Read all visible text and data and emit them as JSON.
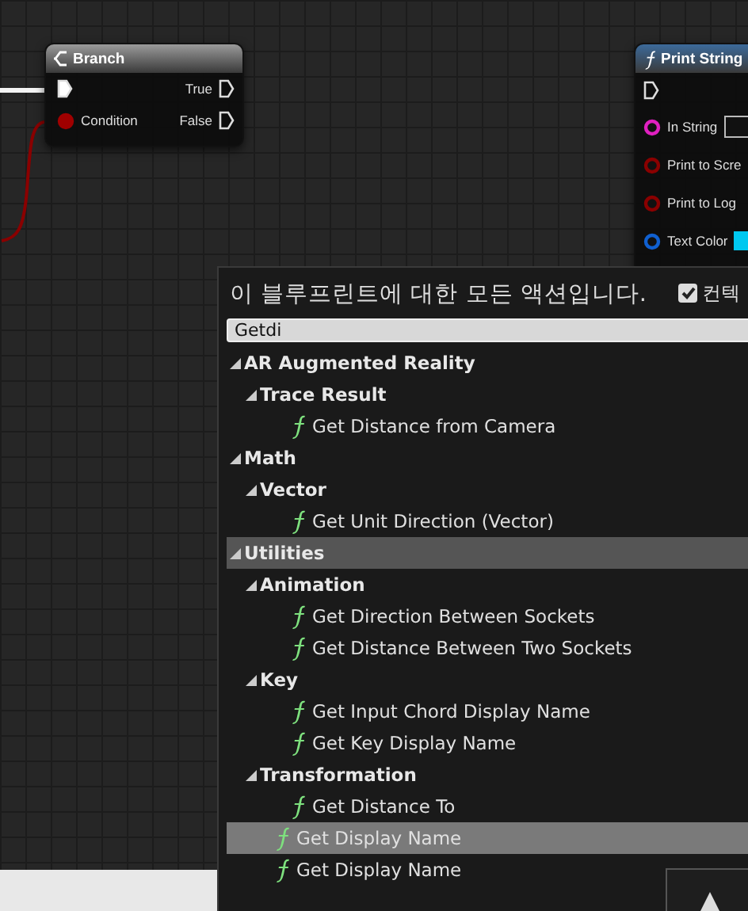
{
  "graph": {
    "branch_node": {
      "title": "Branch",
      "pins_left": [
        {
          "kind": "exec"
        },
        {
          "kind": "bool",
          "label": "Condition"
        }
      ],
      "pins_right": [
        {
          "kind": "exec",
          "label": "True"
        },
        {
          "kind": "exec",
          "label": "False"
        }
      ]
    },
    "print_node": {
      "title": "Print String",
      "pins": [
        {
          "kind": "exec"
        },
        {
          "kind": "string",
          "label": "In String",
          "color": "#e020c0"
        },
        {
          "kind": "bool",
          "label": "Print to Scre",
          "color": "#8a0000"
        },
        {
          "kind": "bool",
          "label": "Print to Log",
          "color": "#8a0000"
        },
        {
          "kind": "color",
          "label": "Text Color",
          "color": "#1060d0"
        }
      ]
    }
  },
  "action_menu": {
    "header": "이 블루프린트에 대한 모든 액션입니다.",
    "context_checkbox": {
      "label": "컨텍",
      "checked": true
    },
    "search": {
      "value": "Getdi"
    },
    "tree": [
      {
        "kind": "category",
        "label": "AR Augmented Reality",
        "expanded": true,
        "highlighted": false,
        "children": [
          {
            "kind": "category",
            "label": "Trace Result",
            "expanded": true,
            "highlighted": false,
            "children": [
              {
                "kind": "function",
                "label": "Get Distance from Camera",
                "selected": false
              }
            ]
          }
        ]
      },
      {
        "kind": "category",
        "label": "Math",
        "expanded": true,
        "highlighted": false,
        "children": [
          {
            "kind": "category",
            "label": "Vector",
            "expanded": true,
            "highlighted": false,
            "children": [
              {
                "kind": "function",
                "label": "Get Unit Direction (Vector)",
                "selected": false
              }
            ]
          }
        ]
      },
      {
        "kind": "category",
        "label": "Utilities",
        "expanded": true,
        "highlighted": true,
        "children": [
          {
            "kind": "category",
            "label": "Animation",
            "expanded": true,
            "highlighted": false,
            "children": [
              {
                "kind": "function",
                "label": "Get Direction Between Sockets",
                "selected": false
              },
              {
                "kind": "function",
                "label": "Get Distance Between Two Sockets",
                "selected": false
              }
            ]
          },
          {
            "kind": "category",
            "label": "Key",
            "expanded": true,
            "highlighted": false,
            "children": [
              {
                "kind": "function",
                "label": "Get Input Chord Display Name",
                "selected": false
              },
              {
                "kind": "function",
                "label": "Get Key Display Name",
                "selected": false
              }
            ]
          },
          {
            "kind": "category",
            "label": "Transformation",
            "expanded": true,
            "highlighted": false,
            "children": [
              {
                "kind": "function",
                "label": "Get Distance To",
                "selected": false
              }
            ]
          },
          {
            "kind": "function",
            "label": "Get Display Name",
            "selected": true
          },
          {
            "kind": "function",
            "label": "Get Display Name",
            "selected": false
          }
        ]
      }
    ]
  }
}
